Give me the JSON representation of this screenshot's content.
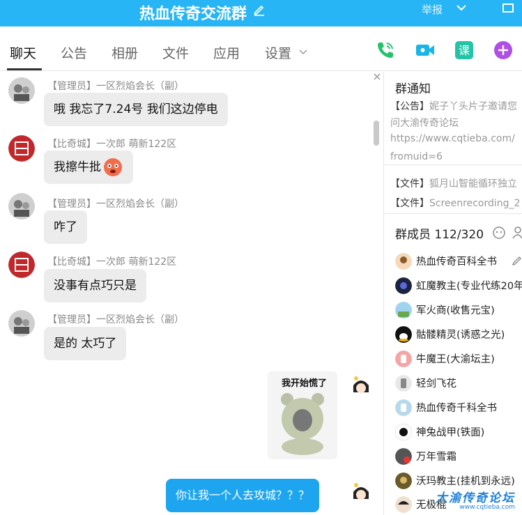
{
  "header": {
    "group_name": "热血传奇交流群",
    "report_label": "举报"
  },
  "tabs": [
    {
      "label": "聊天"
    },
    {
      "label": "公告"
    },
    {
      "label": "相册"
    },
    {
      "label": "文件"
    },
    {
      "label": "应用"
    },
    {
      "label": "设置"
    }
  ],
  "actions": [
    "phone-call-icon",
    "video-call-icon",
    "class-icon",
    "add-app-icon"
  ],
  "messages": [
    {
      "sender": "【管理员】一区烈焰会长（副）",
      "text": "哦  我忘了7.24号   我们这边停电"
    },
    {
      "sender": "【比奇城】一次郎 萌新122区",
      "text": "我擦牛批"
    },
    {
      "sender": "【管理员】一区烈焰会长（副）",
      "text": "咋了"
    },
    {
      "sender": "【比奇城】一次郎 萌新122区",
      "text": "没事有点巧只是"
    },
    {
      "sender": "【管理员】一区烈焰会长（副）",
      "text": "是的  太巧了"
    },
    {
      "sticker_caption": "我开始慌了"
    },
    {
      "text": "你让我一个人去攻城？？？"
    }
  ],
  "panel": {
    "notice_title": "群通知",
    "notice_line1_tag": "【公告】",
    "notice_line1_text": "妮子丫头片子邀请您",
    "notice_line2": "问大渝传奇论坛",
    "notice_line3": "https://www.cqtieba.com/",
    "notice_line4": "fromuid=6",
    "file1_tag": "【文件】",
    "file1_name": "狐月山智能循环独立",
    "file2_tag": "【文件】",
    "file2_name": "Screenrecording_2",
    "members_title": "群成员 112/320",
    "members": [
      {
        "name": "热血传奇百科全书"
      },
      {
        "name": "虹魔教主(专业代练20年"
      },
      {
        "name": "军火商(收售元宝)"
      },
      {
        "name": "骷髅精灵(诱惑之光)"
      },
      {
        "name": "牛魔王(大渝坛主)"
      },
      {
        "name": "轻剑飞花"
      },
      {
        "name": "热血传奇千科全书"
      },
      {
        "name": "神兔战甲(铁面)"
      },
      {
        "name": "万年雪霜"
      },
      {
        "name": "沃玛教主(挂机到永远)"
      },
      {
        "name": "无极棍"
      }
    ]
  },
  "watermark": {
    "main": "大渝传奇论坛",
    "sub": "www.cqtieba.com"
  },
  "colors": {
    "titlebar": "#27b5f5",
    "my_bubble": "#1ea5f0",
    "other_bubble": "#ececec"
  }
}
